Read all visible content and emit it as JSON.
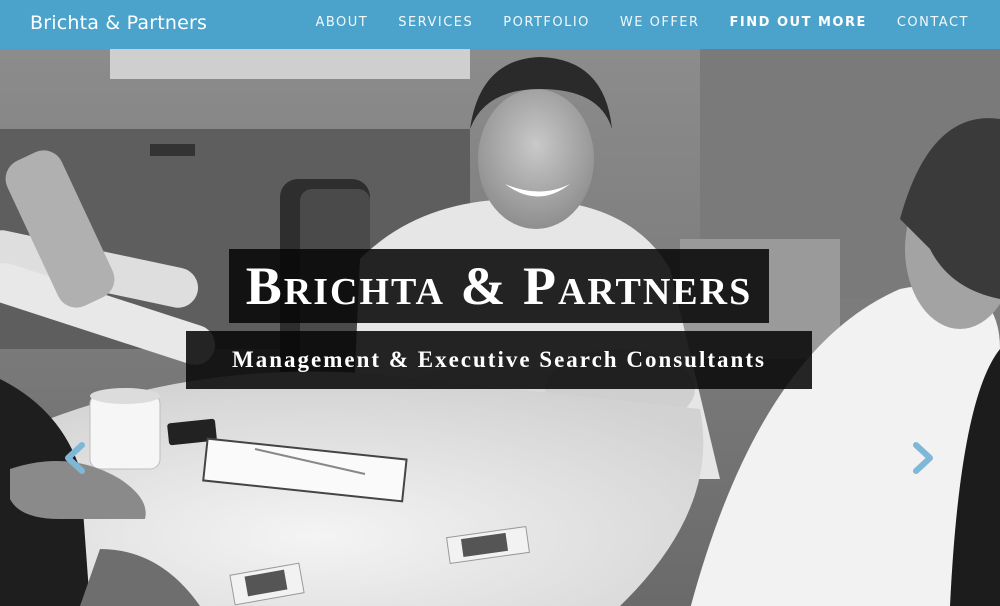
{
  "navbar": {
    "brand": "Brichta & Partners",
    "links": [
      {
        "label": "ABOUT"
      },
      {
        "label": "SERVICES"
      },
      {
        "label": "PORTFOLIO"
      },
      {
        "label": "WE OFFER"
      },
      {
        "label": "FIND OUT MORE"
      },
      {
        "label": "CONTACT"
      }
    ]
  },
  "hero": {
    "title": "Brichta & Partners",
    "subtitle": "Management & Executive Search Consultants",
    "photo": "black-and-white-office-meeting-photo",
    "prev_icon": "chevron-left-icon",
    "next_icon": "chevron-right-icon"
  },
  "colors": {
    "navbar_bg": "#4ba3cc",
    "arrow": "#7fb8d6",
    "box_bg": "#080808"
  }
}
